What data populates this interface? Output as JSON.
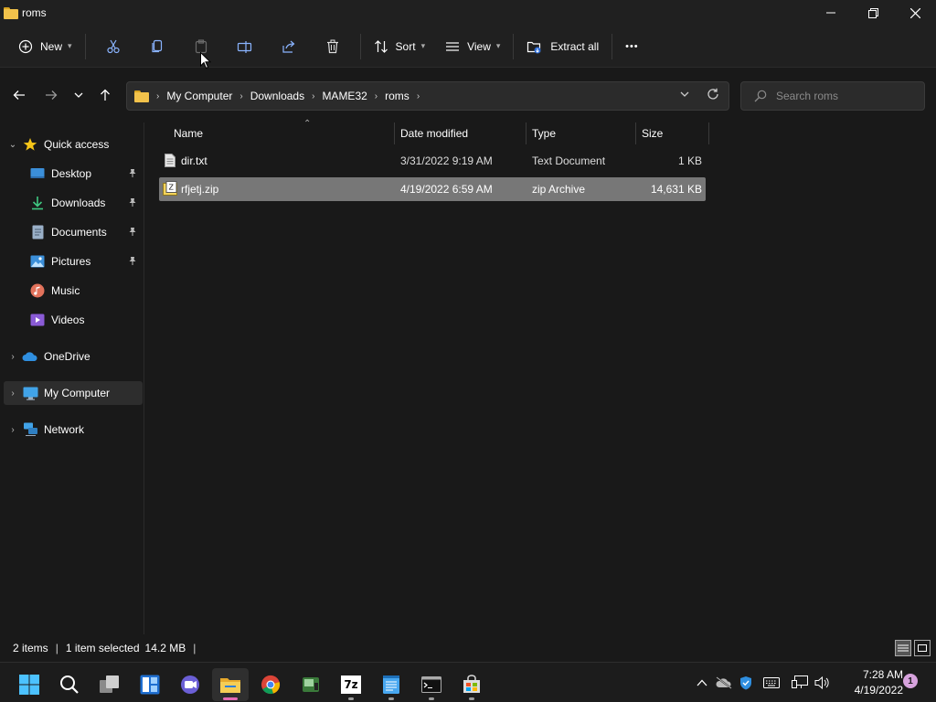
{
  "window": {
    "title": "roms",
    "controls": {
      "minimize": "—",
      "maximize": "❐",
      "close": "✕"
    }
  },
  "commandbar": {
    "new_label": "New",
    "sort_label": "Sort",
    "view_label": "View",
    "extract_label": "Extract all",
    "more_label": "•••"
  },
  "address": {
    "breadcrumbs": [
      "My Computer",
      "Downloads",
      "MAME32",
      "roms"
    ],
    "search_placeholder": "Search roms"
  },
  "navpane": {
    "items": [
      {
        "label": "Quick access",
        "pinned": false
      },
      {
        "label": "Desktop",
        "pinned": true
      },
      {
        "label": "Downloads",
        "pinned": true
      },
      {
        "label": "Documents",
        "pinned": true
      },
      {
        "label": "Pictures",
        "pinned": true
      },
      {
        "label": "Music",
        "pinned": false
      },
      {
        "label": "Videos",
        "pinned": false
      },
      {
        "label": "OneDrive",
        "pinned": false
      },
      {
        "label": "My Computer",
        "pinned": false,
        "selected": true
      },
      {
        "label": "Network",
        "pinned": false
      }
    ]
  },
  "filelist": {
    "columns": {
      "name": "Name",
      "date": "Date modified",
      "type": "Type",
      "size": "Size"
    },
    "rows": [
      {
        "name": "dir.txt",
        "date": "3/31/2022 9:19 AM",
        "type": "Text Document",
        "size": "1 KB",
        "selected": false
      },
      {
        "name": "rfjetj.zip",
        "date": "4/19/2022 6:59 AM",
        "type": "zip Archive",
        "size": "14,631 KB",
        "selected": true
      }
    ]
  },
  "statusbar": {
    "item_count": "2 items",
    "selection": "1 item selected",
    "selection_size": "14.2 MB",
    "trailing": "|"
  },
  "taskbar": {
    "sevenzip_label": "7z",
    "clock_time": "7:28 AM",
    "clock_date": "4/19/2022",
    "notifications": "1"
  },
  "colors": {
    "background": "#191919",
    "toolbar": "#202020",
    "selection": "#777777",
    "folder": "#f2c24b",
    "accent": "#60cdff"
  }
}
